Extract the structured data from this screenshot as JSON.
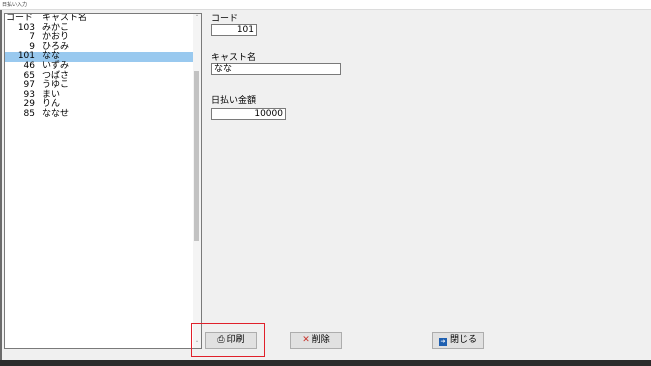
{
  "window": {
    "title": "日払い入力"
  },
  "list": {
    "headers": {
      "code": "コード",
      "name": "キャスト名"
    },
    "rows": [
      {
        "code": "103",
        "name": "みかこ"
      },
      {
        "code": "7",
        "name": "かおり"
      },
      {
        "code": "9",
        "name": "ひろみ"
      },
      {
        "code": "101",
        "name": "なな",
        "selected": true
      },
      {
        "code": "46",
        "name": "いずみ"
      },
      {
        "code": "65",
        "name": "つばさ"
      },
      {
        "code": "97",
        "name": "うゆこ"
      },
      {
        "code": "93",
        "name": "まい"
      },
      {
        "code": "29",
        "name": "りん"
      },
      {
        "code": "85",
        "name": "ななせ"
      }
    ]
  },
  "form": {
    "code_label": "コード",
    "code_value": "101",
    "name_label": "キャスト名",
    "name_value": "なな",
    "amount_label": "日払い金額",
    "amount_value": "10000"
  },
  "buttons": {
    "print": {
      "icon": "printer-icon",
      "label": "印刷"
    },
    "delete": {
      "icon": "delete-icon",
      "label": "削除"
    },
    "close": {
      "icon": "exit-icon",
      "label": "閉じる"
    }
  },
  "colors": {
    "selection": "#99c9ef",
    "highlight": "#e0202a"
  }
}
